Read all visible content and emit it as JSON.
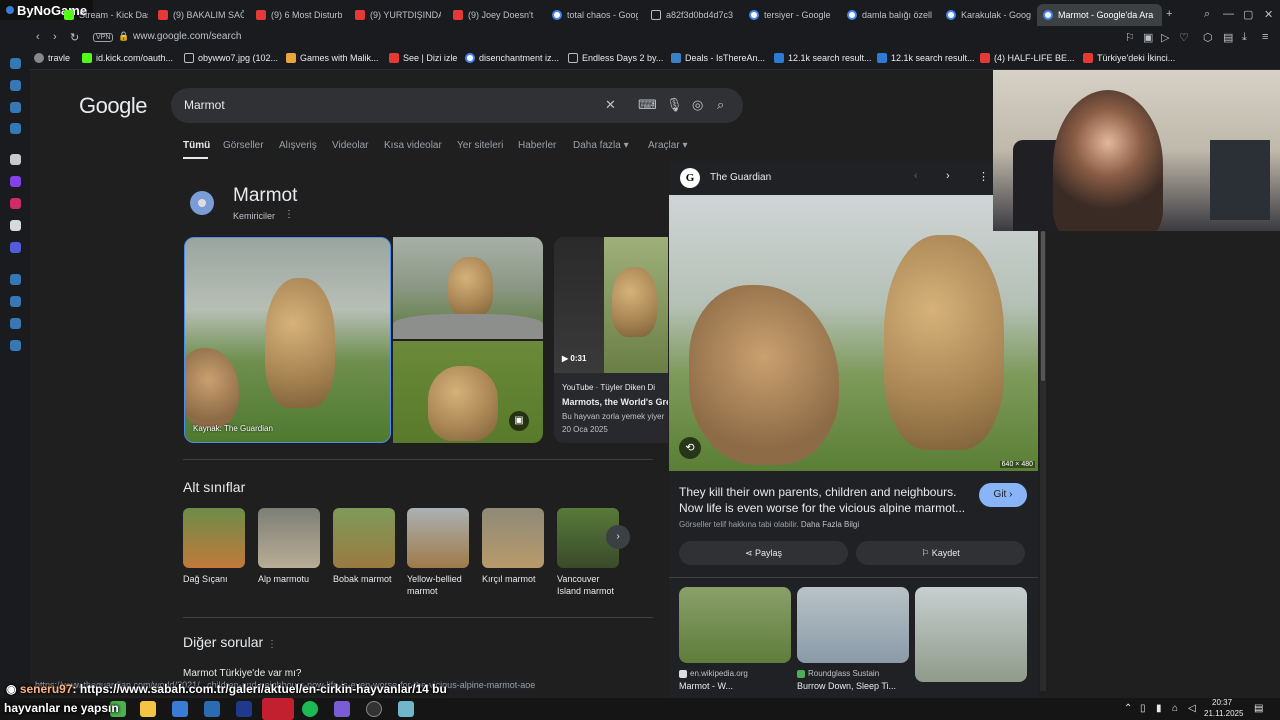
{
  "overlay": {
    "brand": "ByNoGame"
  },
  "tabs": [
    {
      "label": "Stream - Kick Dash",
      "fav": "kick"
    },
    {
      "label": "(9) BAKALIM SAĞ",
      "fav": "yt"
    },
    {
      "label": "(9) 6 Most Disturb",
      "fav": "yt"
    },
    {
      "label": "(9) YURTDIŞINDA",
      "fav": "yt"
    },
    {
      "label": "(9) Joey Doesn't",
      "fav": "yt"
    },
    {
      "label": "total chaos - Goog",
      "fav": "gg"
    },
    {
      "label": "a82f3d0bd4d7c3",
      "fav": "doc"
    },
    {
      "label": "tersiyer - Google",
      "fav": "gg"
    },
    {
      "label": "damla balığı özell",
      "fav": "gg"
    },
    {
      "label": "Karakulak - Goog",
      "fav": "gg"
    },
    {
      "label": "Marmot - Google'da Ara",
      "fav": "gg",
      "active": true
    }
  ],
  "address": {
    "vpn": "VPN",
    "url": "www.google.com/search"
  },
  "bookmarks": [
    "travle",
    "id.kick.com/oauth...",
    "obywwo7.jpg (102...",
    "Games with Malik...",
    "See | Dizi izle",
    "disenchantment iz...",
    "Endless Days 2 by...",
    "Deals - IsThereAn...",
    "12.1k search result...",
    "12.1k search result...",
    "(4) HALF-LIFE BE...",
    "Türkiye'deki İkinci..."
  ],
  "google": {
    "logo": "Google",
    "query": "Marmot",
    "tabs": [
      "Tümü",
      "Görseller",
      "Alışveriş",
      "Videolar",
      "Kısa videolar",
      "Yer siteleri",
      "Haberler",
      "Daha fazla ▾",
      "Araçlar ▾"
    ]
  },
  "knowledge": {
    "title": "Marmot",
    "subtitle": "Kemiriciler",
    "main_caption": "Kaynak: The Guardian",
    "video": {
      "duration": "▶ 0:31",
      "source": "YouTube · Tüyler Diken Di",
      "title": "Marmots, the World's Gre",
      "desc": "Bu hayvan zorla yemek yiyer",
      "date": "20 Oca 2025"
    }
  },
  "subclasses": {
    "heading": "Alt sınıflar",
    "items": [
      "Dağ Sıçanı",
      "Alp marmotu",
      "Bobak marmot",
      "Yellow-bellied marmot",
      "Kırçıl marmot",
      "Vancouver Island marmot"
    ]
  },
  "faq": {
    "heading": "Diğer sorular",
    "q1": "Marmot Türkiye'de var mı?"
  },
  "panel": {
    "source": "The Guardian",
    "dims": "640 × 480",
    "title": "They kill their own parents, children and neighbours. Now life is even worse for the vicious alpine marmot...",
    "go": "Git ›",
    "copyright": "Görseller telif hakkına tabi olabilir.",
    "more_info": "Daha Fazla Bilgi",
    "share": "Paylaş",
    "save": "Kaydet",
    "related": [
      {
        "source": "en.wikipedia.org",
        "title": "Marmot - W..."
      },
      {
        "source": "Roundglass Sustain",
        "title": "Burrow Down, Sleep Ti..."
      },
      {
        "source": "",
        "title": ""
      }
    ]
  },
  "status_url": "https://www.theguardian.com/world/2021/...children-and-neighbours-now-life-is-even-worse-for-the-vicious-alpine-marmot-aoe",
  "chat": {
    "user": "seneru97",
    "line1": ": https://www.sabah.com.tr/galeri/aktuel/en-cirkin-hayvanlar/14 bu",
    "line2": "hayvanlar ne yapsın"
  },
  "clock": {
    "time": "20:37",
    "date": "21.11.2025"
  },
  "colors": {
    "accent": "#8ab4f8",
    "bg": "#1f1f1f",
    "panel": "#202124"
  }
}
